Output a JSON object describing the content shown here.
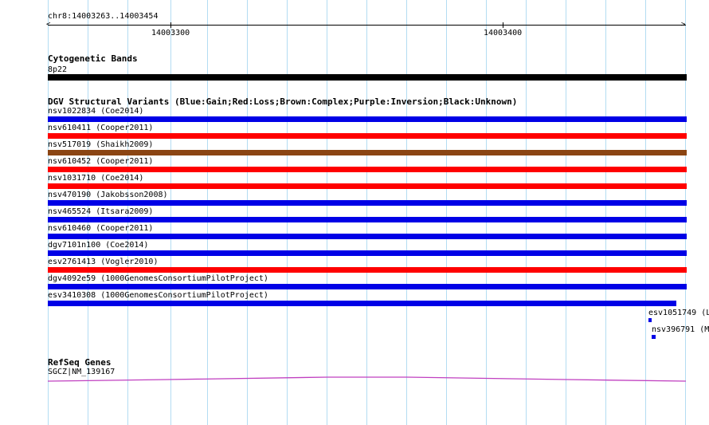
{
  "ruler": {
    "region": "chr8:14003263..14003454",
    "tick_labels": [
      "14003300",
      "14003400"
    ]
  },
  "cytoband": {
    "title": "Cytogenetic Bands",
    "band": "8p22",
    "color": "#000000"
  },
  "dgv": {
    "title": "DGV Structural Variants (Blue:Gain;Red:Loss;Brown:Complex;Purple:Inversion;Black:Unknown)",
    "colors": {
      "gain": "#0000e6",
      "loss": "#ff0000",
      "complex": "#8b4513"
    },
    "variants": [
      {
        "label": "nsv1022834 (Coe2014)",
        "type": "gain"
      },
      {
        "label": "nsv610411 (Cooper2011)",
        "type": "loss"
      },
      {
        "label": "nsv517019 (Shaikh2009)",
        "type": "complex"
      },
      {
        "label": "nsv610452 (Cooper2011)",
        "type": "loss"
      },
      {
        "label": "nsv1031710 (Coe2014)",
        "type": "loss"
      },
      {
        "label": "nsv470190 (Jakobsson2008)",
        "type": "gain"
      },
      {
        "label": "nsv465524 (Itsara2009)",
        "type": "gain"
      },
      {
        "label": "nsv610460 (Cooper2011)",
        "type": "gain"
      },
      {
        "label": "dgv7101n100 (Coe2014)",
        "type": "gain"
      },
      {
        "label": "esv2761413 (Vogler2010)",
        "type": "loss"
      },
      {
        "label": "dgv4092e59 (1000GenomesConsortiumPilotProject)",
        "type": "gain"
      },
      {
        "label": "esv3410308 (1000GenomesConsortiumPilotProject)",
        "type": "gain"
      }
    ],
    "small_variants": [
      {
        "label": "esv1051749 (L"
      },
      {
        "label": "nsv396791 (M"
      }
    ]
  },
  "refseq": {
    "title": "RefSeq Genes",
    "gene": "SGCZ|NM_139167",
    "color": "#c040c0"
  }
}
